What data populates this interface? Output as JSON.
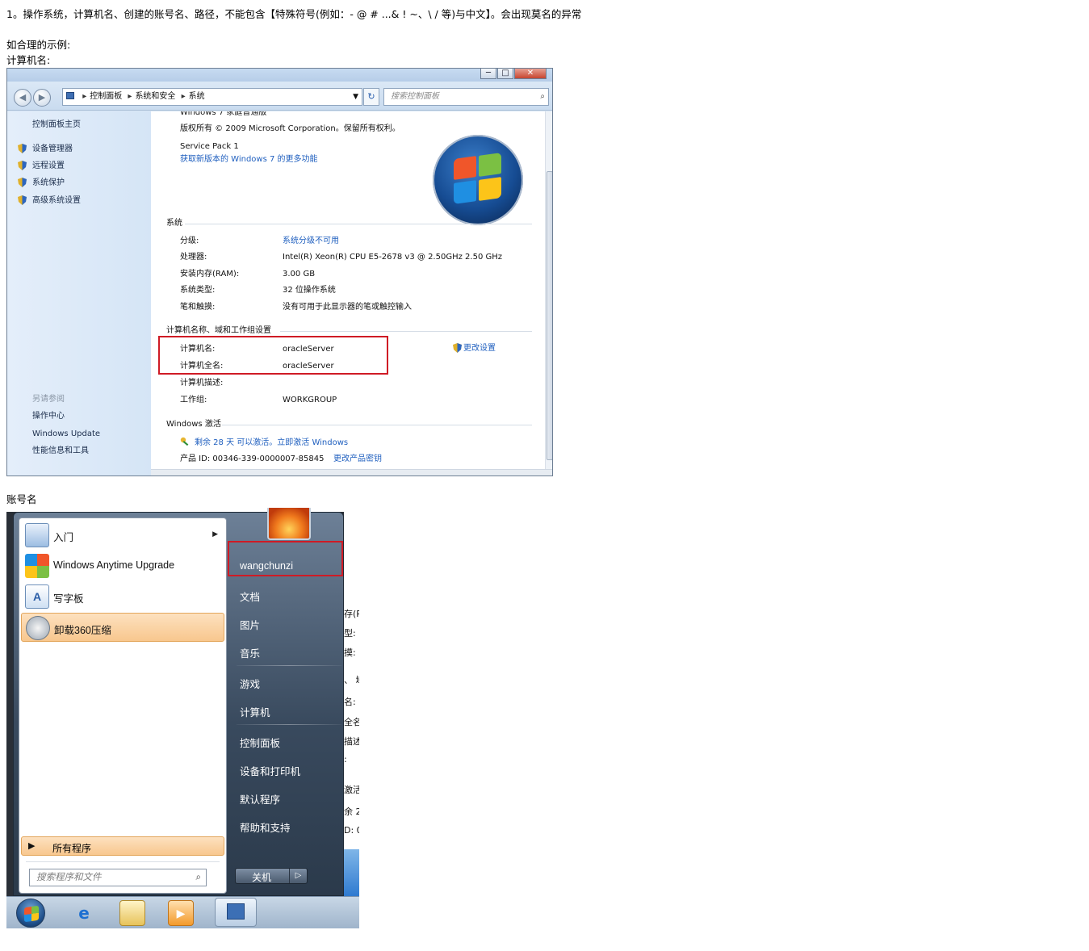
{
  "doc": {
    "note": "1。操作系统，计算机名、创建的账号名、路径，不能包含【特殊符号(例如：- @ # ...& ! ~、\\ / 等)与中文】。会出现莫名的异常",
    "example_heading": "如合理的示例:",
    "computer_name_heading": "计算机名:",
    "account_heading": "账号名"
  },
  "system_window": {
    "caption_buttons": {
      "minimize": "─",
      "maximize": "□",
      "close": "✕"
    },
    "nav": {
      "back_icon": "◀",
      "forward_icon": "▶"
    },
    "breadcrumb": [
      "控制面板",
      "系统和安全",
      "系统"
    ],
    "refresh_icon": "↻",
    "search_placeholder": "搜索控制面板",
    "sidebar": {
      "home": "控制面板主页",
      "items": [
        "设备管理器",
        "远程设置",
        "系统保护",
        "高级系统设置"
      ],
      "see_also": "另请参阅",
      "see_also_items": [
        "操作中心",
        "Windows Update",
        "性能信息和工具"
      ]
    },
    "edition": {
      "name": "Windows 7 家庭普通版",
      "copyright": "版权所有 © 2009 Microsoft Corporation。保留所有权利。",
      "service_pack": "Service Pack 1",
      "upgrade_link": "获取新版本的 Windows 7 的更多功能"
    },
    "system_section": {
      "title": "系统",
      "rows": [
        {
          "label": "分级:",
          "value": "系统分级不可用",
          "link": true
        },
        {
          "label": "处理器:",
          "value": "Intel(R) Xeon(R) CPU E5-2678 v3 @ 2.50GHz   2.50 GHz",
          "link": false
        },
        {
          "label": "安装内存(RAM):",
          "value": "3.00 GB",
          "link": false
        },
        {
          "label": "系统类型:",
          "value": "32 位操作系统",
          "link": false
        },
        {
          "label": "笔和触摸:",
          "value": "没有可用于此显示器的笔或触控输入",
          "link": false
        }
      ]
    },
    "computer_section": {
      "title": "计算机名称、域和工作组设置",
      "rows": [
        {
          "label": "计算机名:",
          "value": "oracleServer"
        },
        {
          "label": "计算机全名:",
          "value": "oracleServer"
        },
        {
          "label": "计算机描述:",
          "value": ""
        },
        {
          "label": "工作组:",
          "value": "WORKGROUP"
        }
      ],
      "change_settings": "更改设置"
    },
    "activation_section": {
      "title": "Windows 激活",
      "activation_text": "剩余 28 天 可以激活。立即激活 Windows",
      "product_id": "产品 ID: 00346-339-0000007-85845",
      "change_key": "更改产品密钥"
    }
  },
  "start_menu": {
    "background_fragments": [
      "存(R",
      "型:",
      "摸:",
      "、 域",
      "名:",
      "全名",
      "描述",
      ":",
      "激活",
      "余 2",
      "D: 0("
    ],
    "programs": [
      {
        "label": "入门",
        "has_submenu": true
      },
      {
        "label": "Windows Anytime Upgrade",
        "has_submenu": false
      },
      {
        "label": "写字板",
        "has_submenu": false
      },
      {
        "label": "卸载360压缩",
        "has_submenu": false
      }
    ],
    "all_programs": "所有程序",
    "search_placeholder": "搜索程序和文件",
    "user_name": "wangchunzi",
    "right_items": [
      "文档",
      "图片",
      "音乐",
      "游戏",
      "计算机",
      "控制面板",
      "设备和打印机",
      "默认程序",
      "帮助和支持"
    ],
    "shutdown": "关机",
    "shutdown_arrow": "▷",
    "colors": {
      "highlight": "#f8c78e",
      "red_box": "#cf1b25",
      "link": "#1f5fbf"
    }
  }
}
